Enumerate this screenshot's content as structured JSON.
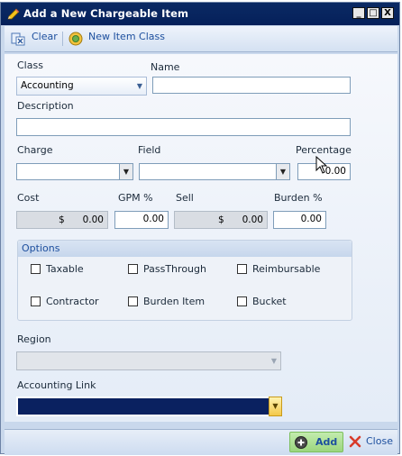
{
  "window": {
    "title": "Add a New Chargeable Item",
    "controls": {
      "minimize": "_",
      "maximize": "□",
      "close": "X"
    }
  },
  "toolbar": {
    "clear_label": "Clear",
    "new_item_class_label": "New Item Class"
  },
  "form": {
    "class_label": "Class",
    "class_value": "Accounting",
    "name_label": "Name",
    "name_value": "",
    "description_label": "Description",
    "description_value": "",
    "charge_label": "Charge",
    "charge_value": "",
    "field_label": "Field",
    "field_value": "",
    "percentage_label": "Percentage",
    "percentage_value": "0.00",
    "cost_label": "Cost",
    "cost_currency": "$",
    "cost_value": "0.00",
    "gpm_label": "GPM %",
    "gpm_value": "0.00",
    "sell_label": "Sell",
    "sell_currency": "$",
    "sell_value": "0.00",
    "burden_label": "Burden %",
    "burden_value": "0.00"
  },
  "options": {
    "title": "Options",
    "taxable": "Taxable",
    "passthrough": "PassThrough",
    "reimbursable": "Reimbursable",
    "contractor": "Contractor",
    "burden_item": "Burden Item",
    "bucket": "Bucket"
  },
  "region": {
    "label": "Region",
    "value": ""
  },
  "accounting_link": {
    "label": "Accounting Link",
    "value": ""
  },
  "footer": {
    "add_label": "Add",
    "close_label": "Close"
  },
  "colors": {
    "title_bar": "#0b2a64",
    "accent": "#1d4f9e",
    "selected_fill": "#0a2160",
    "add_button": "#a9dc8e"
  }
}
